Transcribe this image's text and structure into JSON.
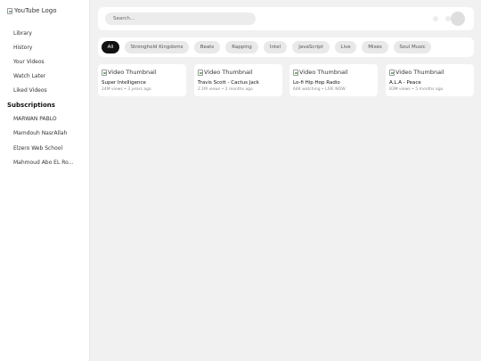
{
  "app": {
    "logo_alt": "YouTube Logo"
  },
  "sidebar": {
    "items": [
      {
        "label": "Library"
      },
      {
        "label": "History"
      },
      {
        "label": "Your Videos"
      },
      {
        "label": "Watch Later"
      },
      {
        "label": "Liked Videos"
      }
    ],
    "subscriptions_title": "Subscriptions",
    "subscriptions": [
      {
        "label": "MARWAN PABLO"
      },
      {
        "label": "Mamdouh NasrAllah"
      },
      {
        "label": "Elzero Web School"
      },
      {
        "label": "Mahmoud Abo EL Ro..."
      }
    ]
  },
  "search": {
    "placeholder": "Search..."
  },
  "chips": [
    {
      "label": "All",
      "active": true
    },
    {
      "label": "Stronghold Kingdoms"
    },
    {
      "label": "Beats"
    },
    {
      "label": "Rapping"
    },
    {
      "label": "Intel"
    },
    {
      "label": "JavaScript"
    },
    {
      "label": "Live"
    },
    {
      "label": "Mixes"
    },
    {
      "label": "Soul Music"
    }
  ],
  "videos": [
    {
      "thumb_alt": "Video Thumbnail",
      "title": "Super Intelligence",
      "meta": "24M views • 3 years ago"
    },
    {
      "thumb_alt": "Video Thumbnail",
      "title": "Travis Scott - Cactus Jack",
      "meta": "2.1M views • 2 months ago"
    },
    {
      "thumb_alt": "Video Thumbnail",
      "title": "Lo-fi Hip Hop Radio",
      "meta": "64K watching • LIVE NOW"
    },
    {
      "thumb_alt": "Video Thumbnail",
      "title": "A.L.A - Peace",
      "meta": "83M views • 5 months ago"
    }
  ]
}
